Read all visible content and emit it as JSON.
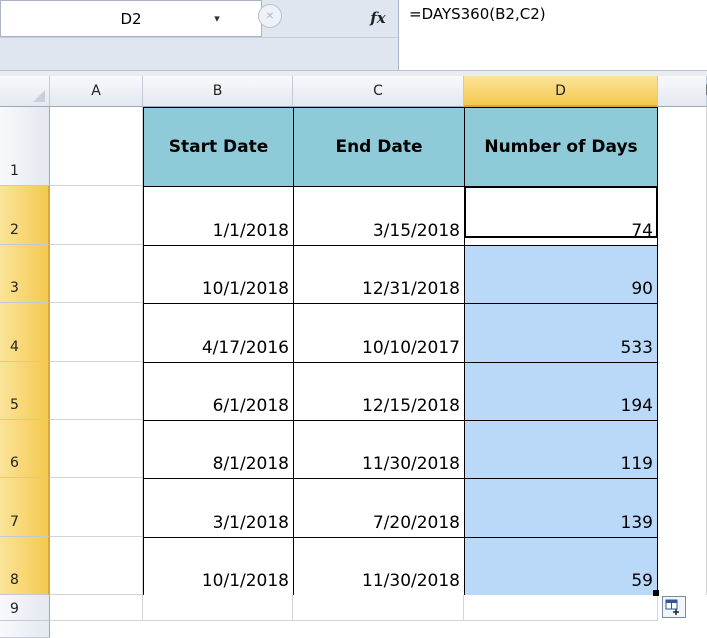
{
  "formula_bar": {
    "name_box": "D2",
    "name_box_dropdown": "▾",
    "fx_label": "fx",
    "formula": "=DAYS360(B2,C2)"
  },
  "columns": [
    "A",
    "B",
    "C",
    "D",
    "E"
  ],
  "rows": [
    "1",
    "2",
    "3",
    "4",
    "5",
    "6",
    "7",
    "8",
    "9"
  ],
  "table": {
    "headers": [
      "Start Date",
      "End Date",
      "Number of Days"
    ],
    "rows": [
      [
        "1/1/2018",
        "3/15/2018",
        "74"
      ],
      [
        "10/1/2018",
        "12/31/2018",
        "90"
      ],
      [
        "4/17/2016",
        "10/10/2017",
        "533"
      ],
      [
        "6/1/2018",
        "12/15/2018",
        "194"
      ],
      [
        "8/1/2018",
        "11/30/2018",
        "119"
      ],
      [
        "3/1/2018",
        "7/20/2018",
        "139"
      ],
      [
        "10/1/2018",
        "11/30/2018",
        "59"
      ]
    ]
  },
  "active_cell": "D2",
  "colors": {
    "header_fill": "#8fcad8",
    "selection_fill": "#bad9f9",
    "header_highlight": "#f4c94e"
  }
}
